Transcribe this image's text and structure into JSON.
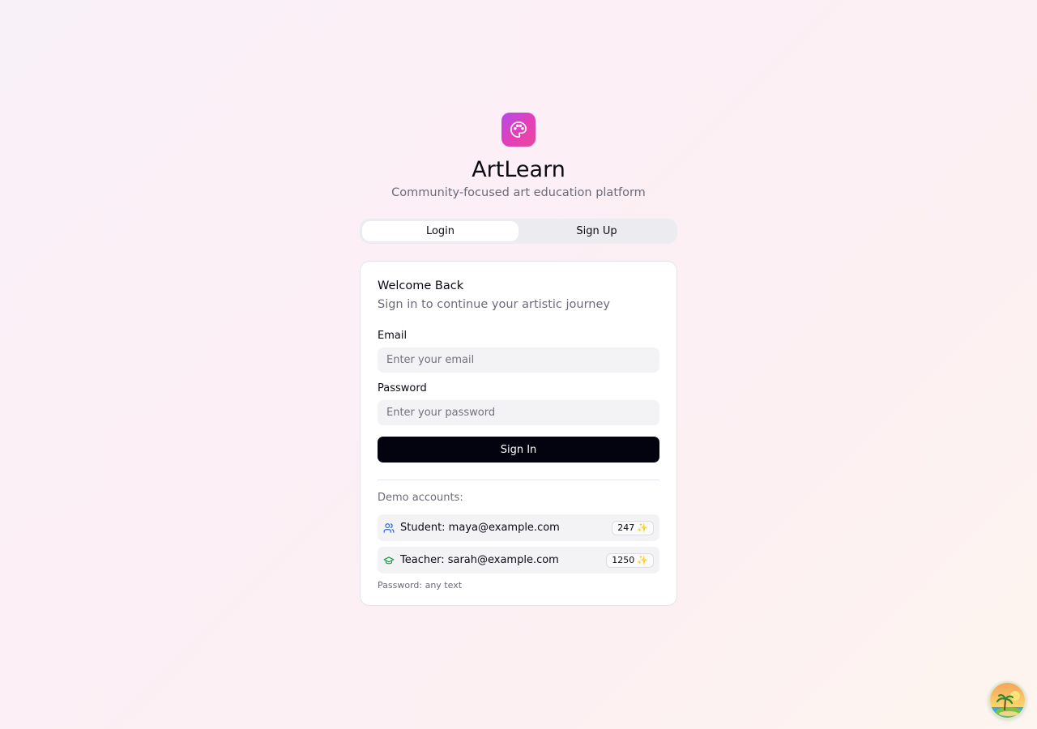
{
  "app": {
    "name": "ArtLearn",
    "tagline": "Community-focused art education platform",
    "logo_icon": "palette-icon",
    "brand_gradient": [
      "#b44bea",
      "#ec4899"
    ]
  },
  "tabs": [
    {
      "label": "Login",
      "active": true
    },
    {
      "label": "Sign Up",
      "active": false
    }
  ],
  "card": {
    "title": "Welcome Back",
    "description": "Sign in to continue your artistic journey",
    "email": {
      "label": "Email",
      "placeholder": "Enter your email",
      "value": ""
    },
    "password": {
      "label": "Password",
      "placeholder": "Enter your password",
      "value": ""
    },
    "submit_label": "Sign In"
  },
  "demo": {
    "heading": "Demo accounts:",
    "accounts": [
      {
        "icon": "users-icon",
        "text": "Student: maya@example.com",
        "points": "247",
        "points_icon": "✨",
        "color": "#2563eb"
      },
      {
        "icon": "graduation-cap-icon",
        "text": "Teacher: sarah@example.com",
        "points": "1250",
        "points_icon": "✨",
        "color": "#16a34a"
      }
    ],
    "password_hint": "Password: any text"
  },
  "corner_widget": {
    "icon": "beach-island-avatar-icon"
  }
}
